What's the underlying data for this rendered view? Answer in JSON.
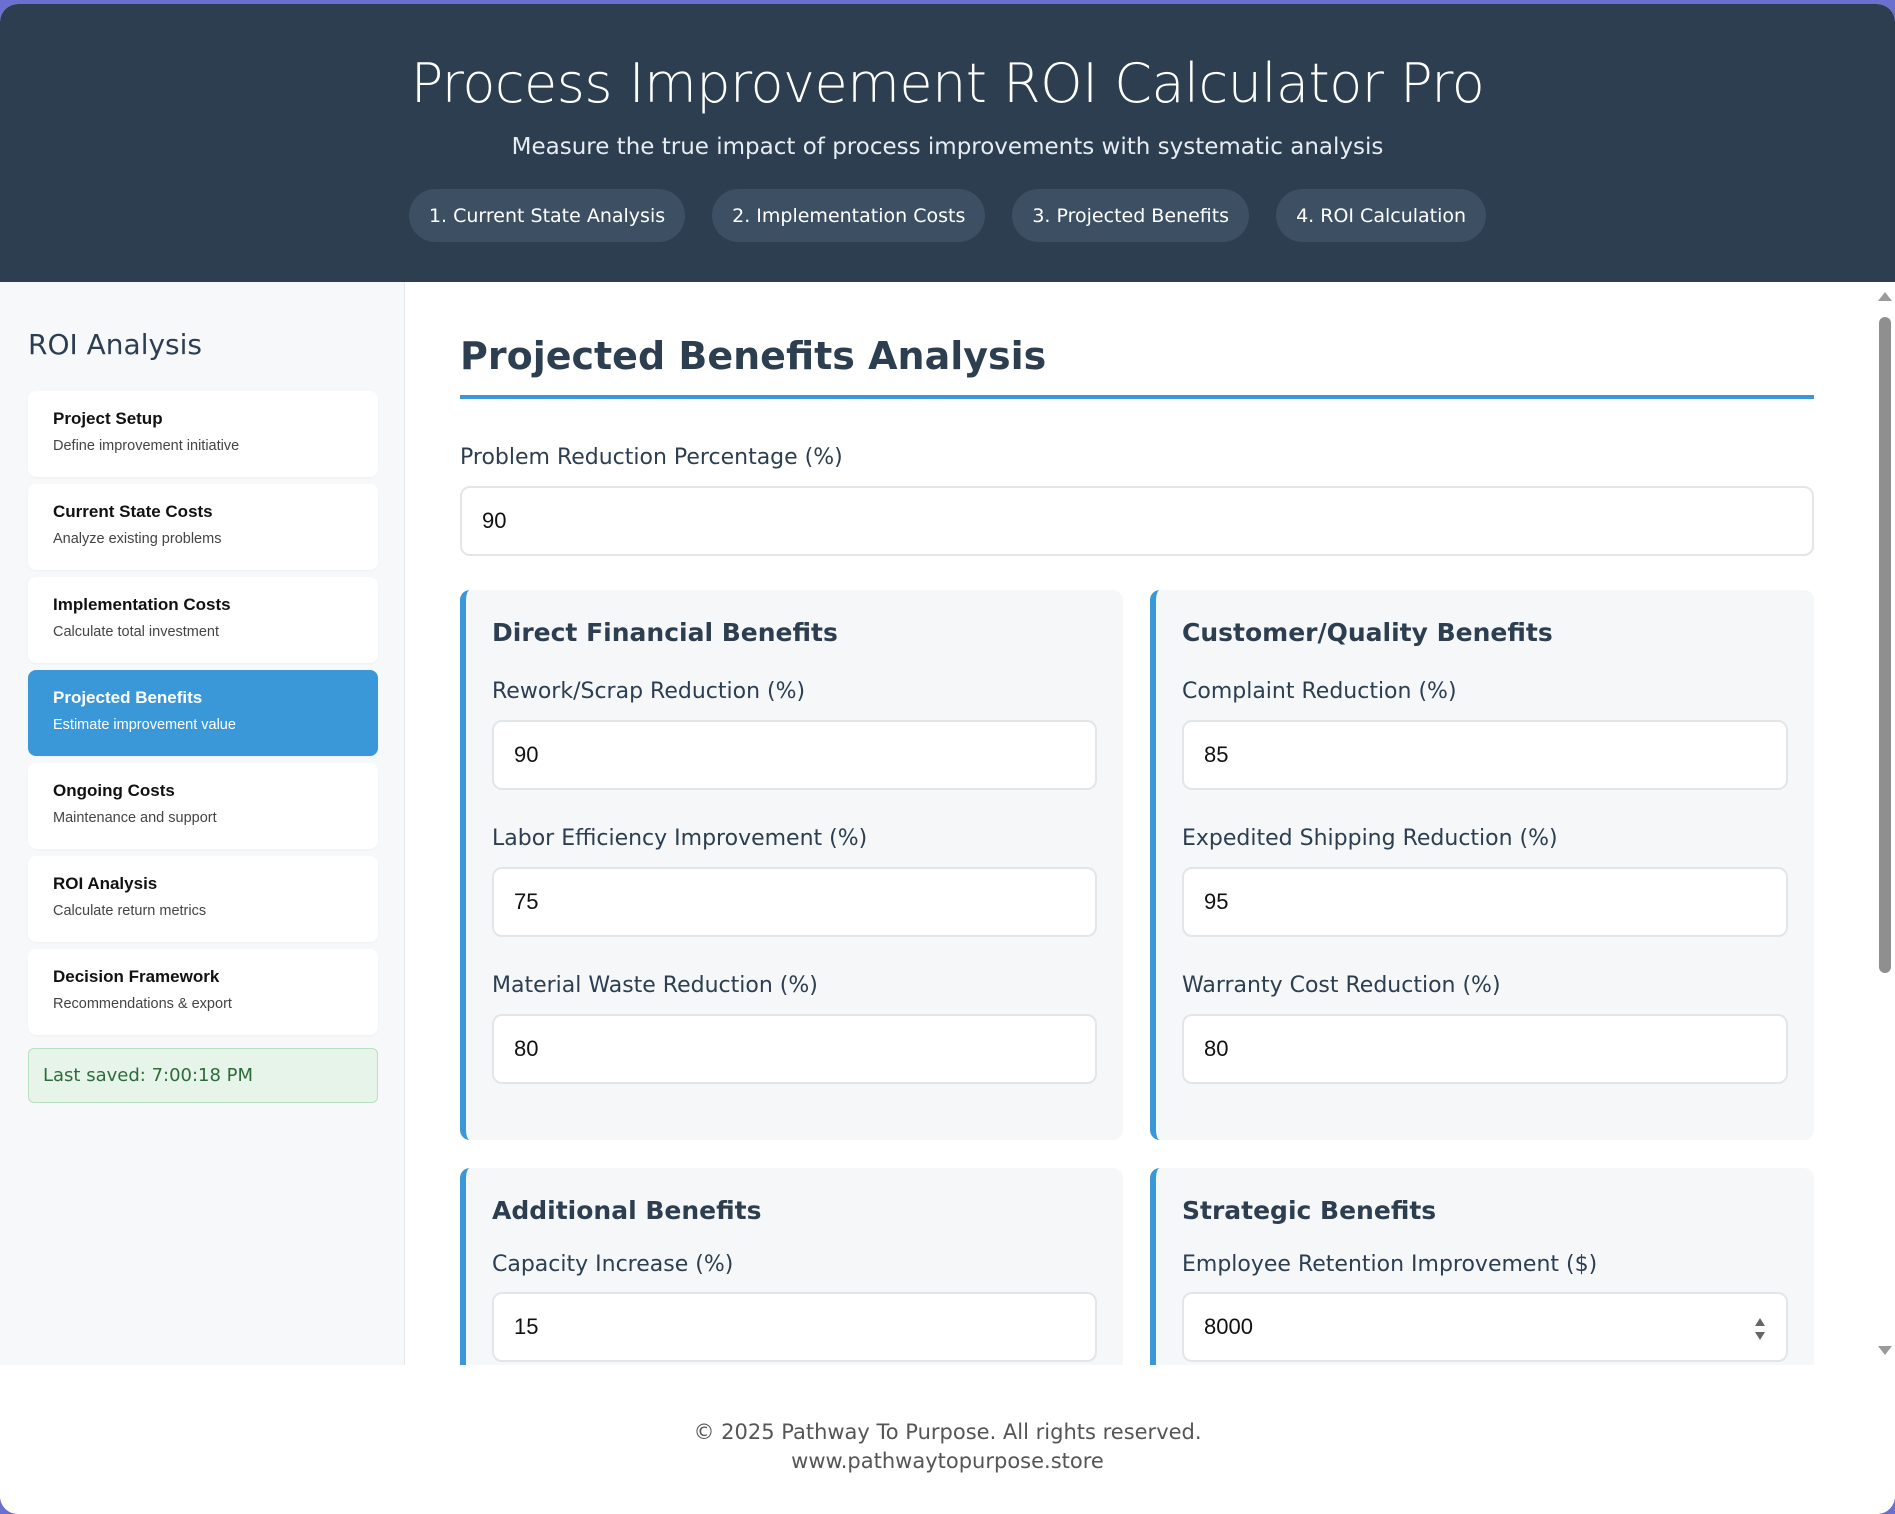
{
  "header": {
    "title": "Process Improvement ROI Calculator Pro",
    "subtitle": "Measure the true impact of process improvements with systematic analysis",
    "steps": [
      "1. Current State Analysis",
      "2. Implementation Costs",
      "3. Projected Benefits",
      "4. ROI Calculation"
    ]
  },
  "sidebar": {
    "title": "ROI Analysis",
    "items": [
      {
        "title": "Project Setup",
        "desc": "Define improvement initiative"
      },
      {
        "title": "Current State Costs",
        "desc": "Analyze existing problems"
      },
      {
        "title": "Implementation Costs",
        "desc": "Calculate total investment"
      },
      {
        "title": "Projected Benefits",
        "desc": "Estimate improvement value"
      },
      {
        "title": "Ongoing Costs",
        "desc": "Maintenance and support"
      },
      {
        "title": "ROI Analysis",
        "desc": "Calculate return metrics"
      },
      {
        "title": "Decision Framework",
        "desc": "Recommendations & export"
      }
    ],
    "active_item": "Projected Benefits",
    "last_saved": "Last saved: 7:00:18 PM"
  },
  "main": {
    "heading": "Projected Benefits Analysis",
    "problem_reduction": {
      "label": "Problem Reduction Percentage (%)",
      "value": "90"
    },
    "direct": {
      "title": "Direct Financial Benefits",
      "fields": [
        {
          "label": "Rework/Scrap Reduction (%)",
          "value": "90"
        },
        {
          "label": "Labor Efficiency Improvement (%)",
          "value": "75"
        },
        {
          "label": "Material Waste Reduction (%)",
          "value": "80"
        }
      ]
    },
    "customer": {
      "title": "Customer/Quality Benefits",
      "fields": [
        {
          "label": "Complaint Reduction (%)",
          "value": "85"
        },
        {
          "label": "Expedited Shipping Reduction (%)",
          "value": "95"
        },
        {
          "label": "Warranty Cost Reduction (%)",
          "value": "80"
        }
      ]
    },
    "additional": {
      "title": "Additional Benefits",
      "fields": [
        {
          "label": "Capacity Increase (%)",
          "value": "15"
        }
      ]
    },
    "strategic": {
      "title": "Strategic Benefits",
      "fields": [
        {
          "label": "Employee Retention Improvement ($)",
          "value": "8000"
        }
      ]
    }
  },
  "footer": {
    "copyright": "© 2025 Pathway To Purpose. All rights reserved.",
    "website": "www.pathwaytopurpose.store"
  },
  "colors": {
    "header_bg": "#2c3e50",
    "accent": "#3a98d8",
    "page_bg": "#6a6fd0",
    "saved_bg": "#e7f4e9"
  }
}
